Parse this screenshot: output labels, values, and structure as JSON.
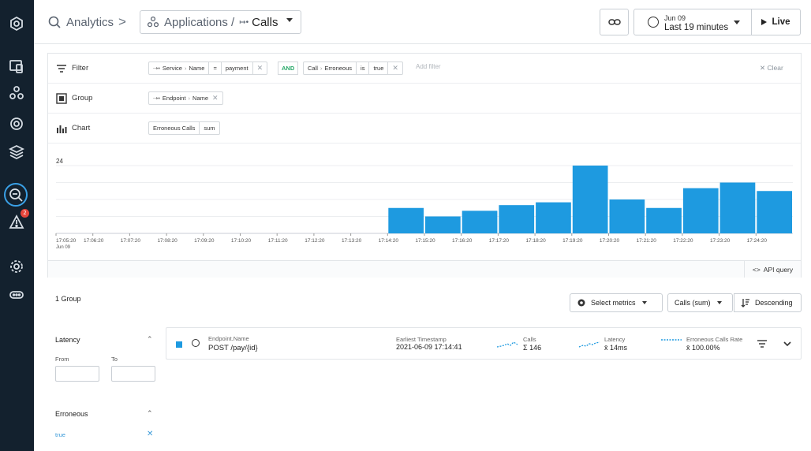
{
  "breadcrumb": {
    "analytics": "Analytics",
    "separator": ">",
    "applications": "Applications /",
    "calls": "Calls"
  },
  "time": {
    "date": "Jun 09",
    "range": "Last 19 minutes",
    "live": "Live"
  },
  "sidebar": {
    "alert_count": "2"
  },
  "filter": {
    "label": "Filter",
    "chip1": {
      "field": "Service",
      "attr": "Name",
      "op": "=",
      "value": "payment"
    },
    "and": "AND",
    "chip2": {
      "field": "Call",
      "attr": "Erroneous",
      "op": "is",
      "value": "true"
    },
    "add": "Add filter",
    "clear": "Clear"
  },
  "group": {
    "label": "Group",
    "chip": {
      "field": "Endpoint",
      "attr": "Name"
    }
  },
  "chartrow": {
    "label": "Chart",
    "metric": "Erroneous Calls",
    "agg": "sum"
  },
  "chart_data": {
    "type": "bar",
    "y_tick": "24",
    "ylim": [
      0,
      24
    ],
    "grid": true,
    "x_ticks": [
      "17:05:20",
      "17:06:20",
      "17:07:20",
      "17:08:20",
      "17:09:20",
      "17:10:20",
      "17:11:20",
      "17:12:20",
      "17:13:20",
      "17:14:20",
      "17:15:20",
      "17:16:20",
      "17:17:20",
      "17:18:20",
      "17:19:20",
      "17:20:20",
      "17:21:20",
      "17:22:20",
      "17:23:20",
      "17:24:20"
    ],
    "x_sub": "Jun 09",
    "values": [
      0,
      0,
      0,
      0,
      0,
      0,
      0,
      0,
      0,
      9,
      6,
      8,
      10,
      11,
      24,
      12,
      9,
      16,
      18,
      15
    ],
    "color": "#1e9ae0"
  },
  "api_query": "API query",
  "results": {
    "count": "1 Group",
    "select_metrics": "Select metrics",
    "sort_metric": "Calls (sum)",
    "order": "Descending"
  },
  "facets": {
    "latency": {
      "title": "Latency",
      "from": "From",
      "to": "To"
    },
    "erroneous": {
      "title": "Erroneous",
      "value": "true"
    }
  },
  "group_row": {
    "caption": "Endpoint.Name",
    "name": "POST /pay/{id}",
    "earliest_caption": "Earliest Timestamp",
    "earliest": "2021-06-09 17:14:41",
    "calls_caption": "Calls",
    "calls": "Σ 146",
    "latency_caption": "Latency",
    "latency": "x̄ 14ms",
    "err_caption": "Erroneous Calls Rate",
    "err": "x̄ 100.00%"
  }
}
